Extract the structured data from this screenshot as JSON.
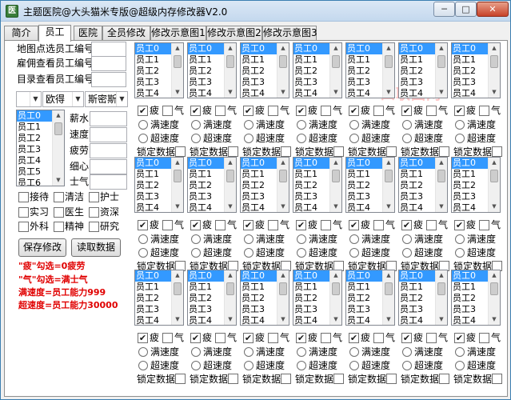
{
  "window": {
    "title": "主题医院@大头猫米专版@超级内存修改器V2.0",
    "app_icon_glyph": "医"
  },
  "titlebar_buttons": {
    "minimize": "─",
    "maximize": "□",
    "close": "✕"
  },
  "tabs": [
    {
      "label": "简介",
      "active": false
    },
    {
      "label": "员工",
      "active": true
    },
    {
      "label": "医院",
      "active": false
    },
    {
      "label": "全员修改",
      "active": false
    },
    {
      "label": "修改示意图1",
      "active": false
    },
    {
      "label": "修改示意图2",
      "active": false
    },
    {
      "label": "修改示意图3",
      "active": false
    }
  ],
  "watermark": "四联图网",
  "lookup": {
    "rows": [
      {
        "label": "地图点选员工编号",
        "value": ""
      },
      {
        "label": "雇佣查看员工编号",
        "value": ""
      },
      {
        "label": "目录查看员工编号",
        "value": ""
      }
    ]
  },
  "combos": [
    "",
    "欧得",
    "斯密斯"
  ],
  "staff_list": [
    "员工0",
    "员工1",
    "员工2",
    "员工3",
    "员工4",
    "员工5",
    "员工6"
  ],
  "attributes": [
    "薪水",
    "速度",
    "疲劳",
    "细心",
    "士气"
  ],
  "skills": [
    [
      "接待",
      "清洁",
      "护士"
    ],
    [
      "实习",
      "医生",
      "资深"
    ],
    [
      "外科",
      "精神",
      "研究"
    ]
  ],
  "buttons": {
    "save": "保存修改",
    "read": "读取数据"
  },
  "notes": [
    "\"疲\"勾选=0疲劳",
    "\"气\"勾选=满士气",
    "满速度=员工能力999",
    "超速度=员工能力30000"
  ],
  "group_list_items": [
    "员工0",
    "员工1",
    "员工2",
    "员工3",
    "员工4"
  ],
  "group_controls": {
    "fatigue": "疲",
    "morale": "气",
    "full_speed": "满速度",
    "super_speed": "超速度",
    "lock": "锁定数据"
  },
  "check_mark": "✔",
  "scroll_up": "▲",
  "scroll_down": "▼",
  "combo_arrow": "▼"
}
